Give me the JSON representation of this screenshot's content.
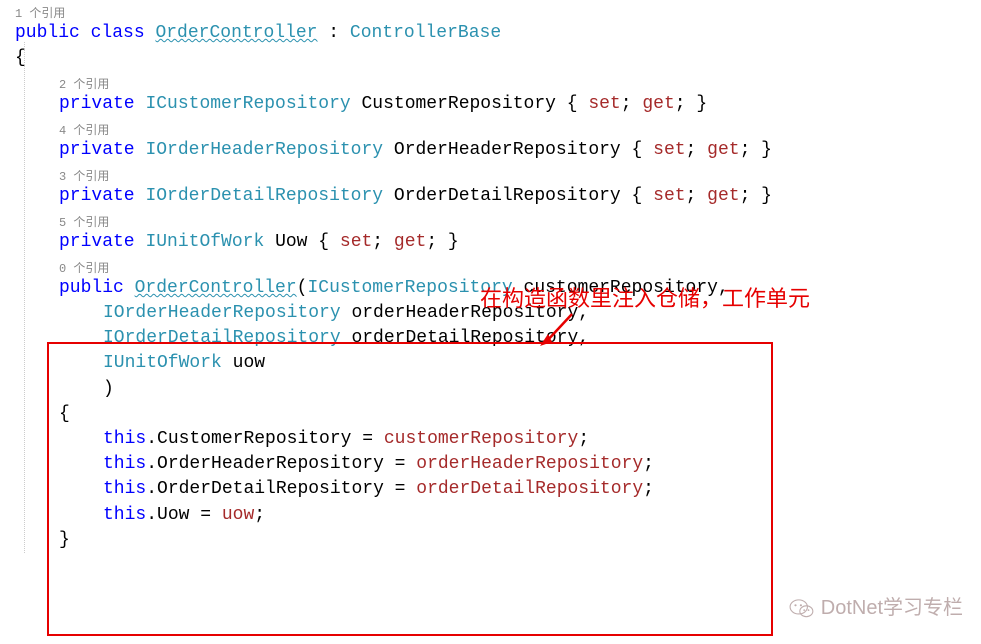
{
  "codelens": {
    "ref_label": "个引用",
    "line0": "1",
    "line1": "2",
    "line2": "4",
    "line3": "3",
    "line4": "5",
    "line5": "0"
  },
  "kw": {
    "public": "public",
    "class": "class",
    "private": "private",
    "set": "set",
    "get": "get",
    "this": "this"
  },
  "decl": {
    "className": "OrderController",
    "baseClass": "ControllerBase",
    "open_brace": "{",
    "close_brace": "}"
  },
  "props": {
    "p1_type": "ICustomerRepository",
    "p1_name": "CustomerRepository",
    "p2_type": "IOrderHeaderRepository",
    "p2_name": "OrderHeaderRepository",
    "p3_type": "IOrderDetailRepository",
    "p3_name": "OrderDetailRepository",
    "p4_type": "IUnitOfWork",
    "p4_name": "Uow"
  },
  "ctor": {
    "name": "OrderController",
    "a1_type": "ICustomerRepository",
    "a1_name": "customerRepository",
    "a2_type": "IOrderHeaderRepository",
    "a2_name": "orderHeaderRepository",
    "a3_type": "IOrderDetailRepository",
    "a3_name": "orderDetailRepository",
    "a4_type": "IUnitOfWork",
    "a4_name": "uow"
  },
  "body": {
    "asn1_lhs": "CustomerRepository",
    "asn1_rhs": "customerRepository",
    "asn2_lhs": "OrderHeaderRepository",
    "asn2_rhs": "orderHeaderRepository",
    "asn3_lhs": "OrderDetailRepository",
    "asn3_rhs": "orderDetailRepository",
    "asn4_lhs": "Uow",
    "asn4_rhs": "uow"
  },
  "annotation": "在构造函数里注入仓储，工作单元",
  "watermark": "DotNet学习专栏",
  "colors": {
    "highlight_box": "#e60000",
    "keyword": "#0000ff",
    "type": "#2b91af",
    "accessor": "#a52a2a"
  }
}
